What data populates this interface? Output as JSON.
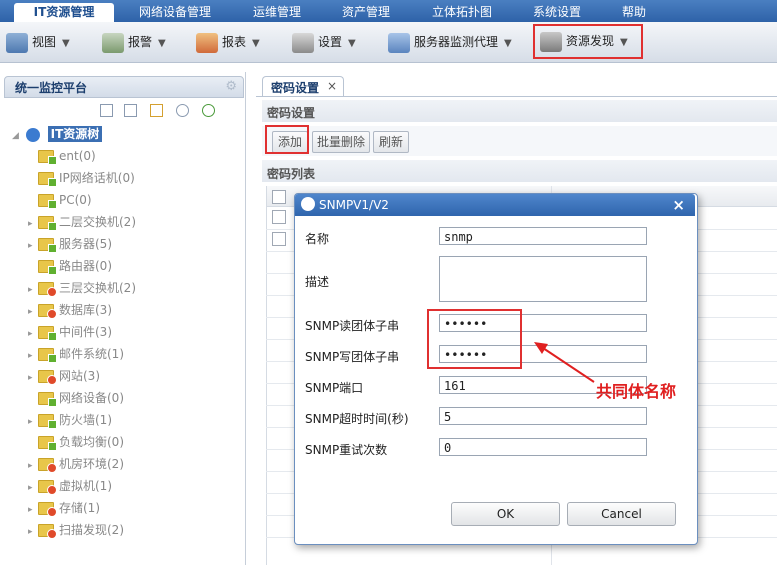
{
  "nav": {
    "tabs": [
      "IT资源管理",
      "网络设备管理",
      "运维管理",
      "资产管理",
      "立体拓扑图",
      "系统设置",
      "帮助"
    ]
  },
  "toolbar": {
    "items": [
      "视图",
      "报警",
      "报表",
      "设置",
      "服务器监测代理",
      "资源发现"
    ]
  },
  "left_panel": {
    "title": "统一监控平台",
    "root": "IT资源树",
    "items": [
      {
        "label": "ent(0)",
        "expandable": false,
        "status": "normal"
      },
      {
        "label": "IP网络话机(0)",
        "expandable": false,
        "status": "normal"
      },
      {
        "label": "PC(0)",
        "expandable": false,
        "status": "normal"
      },
      {
        "label": "二层交换机(2)",
        "expandable": true,
        "status": "normal"
      },
      {
        "label": "服务器(5)",
        "expandable": true,
        "status": "normal"
      },
      {
        "label": "路由器(0)",
        "expandable": false,
        "status": "normal"
      },
      {
        "label": "三层交换机(2)",
        "expandable": true,
        "status": "alert"
      },
      {
        "label": "数据库(3)",
        "expandable": true,
        "status": "alert"
      },
      {
        "label": "中间件(3)",
        "expandable": true,
        "status": "normal"
      },
      {
        "label": "邮件系统(1)",
        "expandable": true,
        "status": "normal"
      },
      {
        "label": "网站(3)",
        "expandable": true,
        "status": "alert"
      },
      {
        "label": "网络设备(0)",
        "expandable": false,
        "status": "normal"
      },
      {
        "label": "防火墙(1)",
        "expandable": true,
        "status": "normal"
      },
      {
        "label": "负载均衡(0)",
        "expandable": false,
        "status": "normal"
      },
      {
        "label": "机房环境(2)",
        "expandable": true,
        "status": "alert"
      },
      {
        "label": "虚拟机(1)",
        "expandable": true,
        "status": "alert"
      },
      {
        "label": "存储(1)",
        "expandable": true,
        "status": "alert"
      },
      {
        "label": "扫描发现(2)",
        "expandable": true,
        "status": "alert"
      }
    ]
  },
  "right_panel": {
    "tab": "密码设置",
    "tab_close": "×",
    "section_title": "密码设置",
    "buttons": {
      "add": "添加",
      "batch_delete": "批量删除",
      "refresh": "刷新"
    },
    "list_title": "密码列表"
  },
  "dialog": {
    "title": "SNMPV1/V2",
    "close": "×",
    "fields": {
      "name_label": "名称",
      "name_value": "snmp",
      "desc_label": "描述",
      "desc_value": "",
      "read_label": "SNMP读团体子串",
      "read_value": "••••••",
      "write_label": "SNMP写团体子串",
      "write_value": "••••••",
      "port_label": "SNMP端口",
      "port_value": "161",
      "timeout_label": "SNMP超时时间(秒)",
      "timeout_value": "5",
      "retry_label": "SNMP重试次数",
      "retry_value": "0"
    },
    "ok": "OK",
    "cancel": "Cancel"
  },
  "annotation": {
    "text": "共同体名称",
    "color": "#e02020"
  },
  "colors": {
    "nav_bg": "#3a6fb5",
    "highlight_red": "#e03030",
    "folder": "#e8c64a"
  }
}
